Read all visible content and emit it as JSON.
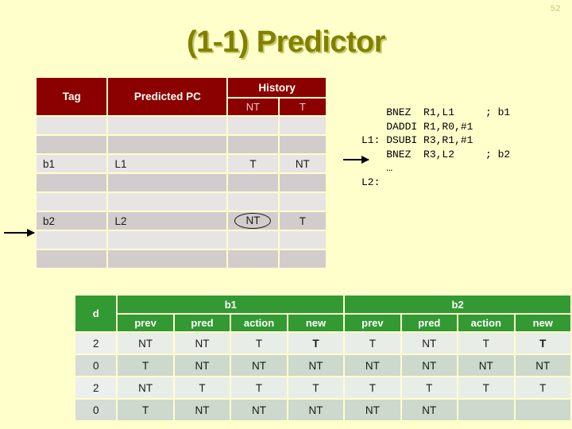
{
  "slide": {
    "page_number": "52",
    "title": "(1-1) Predictor",
    "background_color": "#FFFFCC",
    "title_color": "#808000",
    "title_shadow_color": "#C8C868"
  },
  "btb_table": {
    "header_bg": "#8B0000",
    "header_text_color": "#FFFFF0",
    "columns": {
      "tag": "Tag",
      "predicted_pc": "Predicted PC",
      "history": "History",
      "history_nt": "NT",
      "history_t": "T"
    },
    "rows": [
      {
        "tag": "",
        "pc": "",
        "nt": "",
        "t": "",
        "nt_circled": false
      },
      {
        "tag": "",
        "pc": "",
        "nt": "",
        "t": "",
        "nt_circled": false
      },
      {
        "tag": "b1",
        "pc": "L1",
        "nt": "T",
        "t": "NT",
        "nt_circled": false
      },
      {
        "tag": "",
        "pc": "",
        "nt": "",
        "t": "",
        "nt_circled": false
      },
      {
        "tag": "",
        "pc": "",
        "nt": "",
        "t": "",
        "nt_circled": false
      },
      {
        "tag": "b2",
        "pc": "L2",
        "nt": "NT",
        "t": "T",
        "nt_circled": true
      },
      {
        "tag": "",
        "pc": "",
        "nt": "",
        "t": "",
        "nt_circled": false
      },
      {
        "tag": "",
        "pc": "",
        "nt": "",
        "t": "",
        "nt_circled": false
      }
    ]
  },
  "code": {
    "text": "    BNEZ  R1,L1     ; b1\n    DADDI R1,R0,#1\nL1: DSUBI R3,R1,#1\n    BNEZ  R3,L2     ; b2\n    …\nL2:"
  },
  "trace_table": {
    "header_bg": "#339933",
    "header_text_color": "#FFFFFF",
    "d_label": "d",
    "groups": [
      "b1",
      "b2"
    ],
    "subcolumns": [
      "prev",
      "pred",
      "action",
      "new"
    ],
    "rows": [
      {
        "d": "2",
        "b1": {
          "prev": "NT",
          "pred": "NT",
          "action": "T",
          "new": "T"
        },
        "b2": {
          "prev": "T",
          "pred": "NT",
          "action": "T",
          "new": "T"
        },
        "b1_new_highlight": true,
        "b2_new_highlight": true
      },
      {
        "d": "0",
        "b1": {
          "prev": "T",
          "pred": "NT",
          "action": "NT",
          "new": "NT"
        },
        "b2": {
          "prev": "NT",
          "pred": "NT",
          "action": "NT",
          "new": "NT"
        },
        "b1_new_highlight": false,
        "b2_new_highlight": false
      },
      {
        "d": "2",
        "b1": {
          "prev": "NT",
          "pred": "T",
          "action": "T",
          "new": "T"
        },
        "b2": {
          "prev": "T",
          "pred": "T",
          "action": "T",
          "new": "T"
        },
        "b1_new_highlight": false,
        "b2_new_highlight": false
      },
      {
        "d": "0",
        "b1": {
          "prev": "T",
          "pred": "NT",
          "action": "NT",
          "new": "NT"
        },
        "b2": {
          "prev": "NT",
          "pred": "NT",
          "action": "",
          "new": ""
        },
        "b1_new_highlight": false,
        "b2_new_highlight": false
      }
    ],
    "highlight_color": "#C00000"
  }
}
